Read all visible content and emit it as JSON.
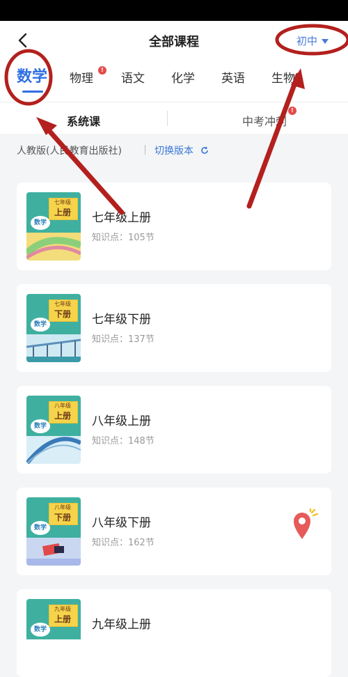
{
  "header": {
    "title": "全部课程",
    "level_label": "初中"
  },
  "subjects": [
    {
      "label": "数学"
    },
    {
      "label": "物理"
    },
    {
      "label": "语文"
    },
    {
      "label": "化学"
    },
    {
      "label": "英语"
    },
    {
      "label": "生物"
    }
  ],
  "tabs": {
    "left": "系统课",
    "right": "中考冲刺"
  },
  "edition": {
    "label": "人教版(人民教育出版社)",
    "switch_label": "切换版本"
  },
  "courses": [
    {
      "name": "七年级上册",
      "count": "知识点：105节",
      "cover_grade": "七年级",
      "cover_vol": "上册",
      "cover_subject": "数学"
    },
    {
      "name": "七年级下册",
      "count": "知识点：137节",
      "cover_grade": "七年级",
      "cover_vol": "下册",
      "cover_subject": "数学"
    },
    {
      "name": "八年级上册",
      "count": "知识点：148节",
      "cover_grade": "八年级",
      "cover_vol": "上册",
      "cover_subject": "数学"
    },
    {
      "name": "八年级下册",
      "count": "知识点：162节",
      "cover_grade": "八年级",
      "cover_vol": "下册",
      "cover_subject": "数学"
    },
    {
      "name": "九年级上册",
      "count": "",
      "cover_grade": "九年级",
      "cover_vol": "上册",
      "cover_subject": "数学"
    }
  ],
  "colors": {
    "accent": "#2f6fe4",
    "annotation": "#b3201d"
  }
}
